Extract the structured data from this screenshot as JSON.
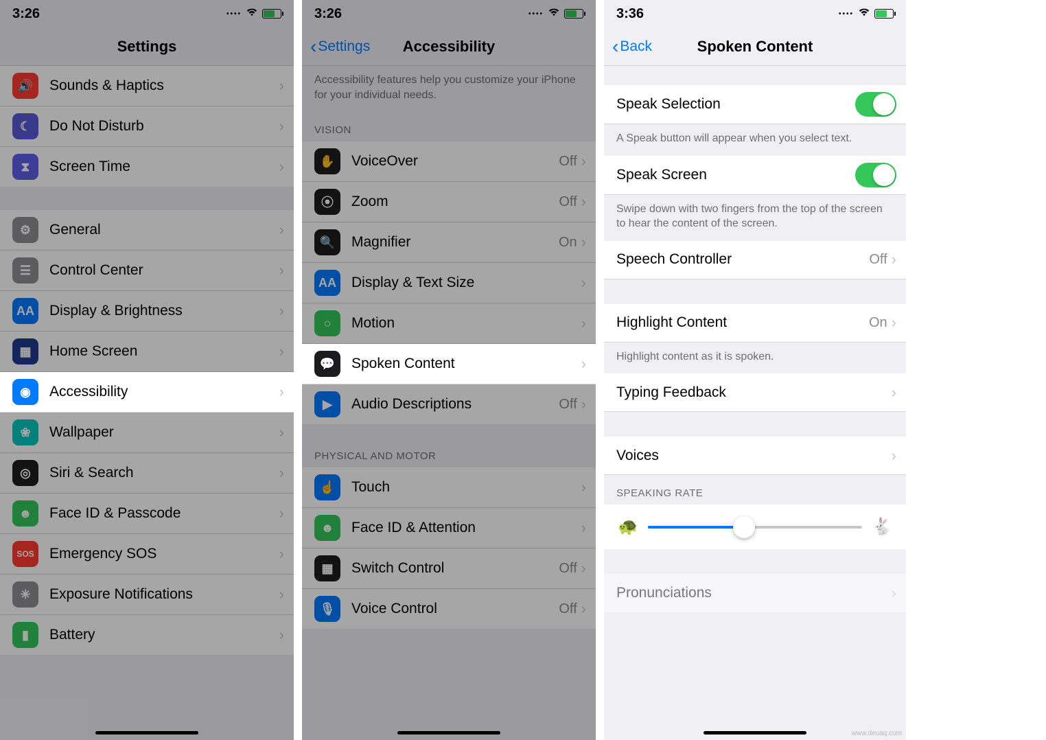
{
  "screens": {
    "settings": {
      "time": "3:26",
      "title": "Settings",
      "groups": [
        {
          "items": [
            {
              "icon": "speaker-icon",
              "color": "ic-red",
              "glyph": "🔊",
              "label": "Sounds & Haptics"
            },
            {
              "icon": "moon-icon",
              "color": "ic-purple",
              "glyph": "☾",
              "label": "Do Not Disturb"
            },
            {
              "icon": "hourglass-icon",
              "color": "ic-indigo",
              "glyph": "⧗",
              "label": "Screen Time"
            }
          ]
        },
        {
          "items": [
            {
              "icon": "gear-icon",
              "color": "ic-gray",
              "glyph": "⚙",
              "label": "General"
            },
            {
              "icon": "switches-icon",
              "color": "ic-gray",
              "glyph": "☰",
              "label": "Control Center"
            },
            {
              "icon": "textsize-icon",
              "color": "ic-blue",
              "glyph": "AA",
              "label": "Display & Brightness"
            },
            {
              "icon": "grid-icon",
              "color": "ic-dkblue",
              "glyph": "▦",
              "label": "Home Screen"
            },
            {
              "icon": "accessibility-icon",
              "color": "ic-blue",
              "glyph": "◉",
              "label": "Accessibility",
              "highlight": true
            },
            {
              "icon": "wallpaper-icon",
              "color": "ic-teal",
              "glyph": "❀",
              "label": "Wallpaper"
            },
            {
              "icon": "siri-icon",
              "color": "ic-black",
              "glyph": "◎",
              "label": "Siri & Search"
            },
            {
              "icon": "faceid-icon",
              "color": "ic-green",
              "glyph": "☻",
              "label": "Face ID & Passcode"
            },
            {
              "icon": "sos-icon",
              "color": "ic-red",
              "glyph": "SOS",
              "label": "Emergency SOS"
            },
            {
              "icon": "exposure-icon",
              "color": "ic-gray",
              "glyph": "✳",
              "label": "Exposure Notifications"
            },
            {
              "icon": "battery-icon",
              "color": "ic-green",
              "glyph": "▮",
              "label": "Battery"
            }
          ]
        }
      ]
    },
    "accessibility": {
      "time": "3:26",
      "back": "Settings",
      "title": "Accessibility",
      "intro": "Accessibility features help you customize your iPhone for your individual needs.",
      "groups": [
        {
          "header": "VISION",
          "items": [
            {
              "icon": "voiceover-icon",
              "color": "ic-black",
              "glyph": "✋",
              "label": "VoiceOver",
              "value": "Off"
            },
            {
              "icon": "zoom-icon",
              "color": "ic-black",
              "glyph": "⦿",
              "label": "Zoom",
              "value": "Off"
            },
            {
              "icon": "magnifier-icon",
              "color": "ic-black",
              "glyph": "🔍",
              "label": "Magnifier",
              "value": "On"
            },
            {
              "icon": "textsize-icon",
              "color": "ic-blue",
              "glyph": "AA",
              "label": "Display & Text Size"
            },
            {
              "icon": "motion-icon",
              "color": "ic-green",
              "glyph": "○",
              "label": "Motion"
            },
            {
              "icon": "spoken-icon",
              "color": "ic-black",
              "glyph": "💬",
              "label": "Spoken Content",
              "highlight": true
            },
            {
              "icon": "audiodesc-icon",
              "color": "ic-blue",
              "glyph": "▶",
              "label": "Audio Descriptions",
              "value": "Off"
            }
          ]
        },
        {
          "header": "PHYSICAL AND MOTOR",
          "items": [
            {
              "icon": "touch-icon",
              "color": "ic-blue",
              "glyph": "☝",
              "label": "Touch"
            },
            {
              "icon": "faceid-icon",
              "color": "ic-green",
              "glyph": "☻",
              "label": "Face ID & Attention"
            },
            {
              "icon": "switch-icon",
              "color": "ic-black",
              "glyph": "▦",
              "label": "Switch Control",
              "value": "Off"
            },
            {
              "icon": "voice-icon",
              "color": "ic-blue",
              "glyph": "🎙",
              "label": "Voice Control",
              "value": "Off"
            }
          ]
        }
      ]
    },
    "spoken": {
      "time": "3:36",
      "back": "Back",
      "title": "Spoken Content",
      "sections": {
        "speakSelection": {
          "label": "Speak Selection",
          "on": true,
          "footer": "A Speak button will appear when you select text."
        },
        "speakScreen": {
          "label": "Speak Screen",
          "on": true,
          "footer": "Swipe down with two fingers from the top of the screen to hear the content of the screen."
        },
        "speechController": {
          "label": "Speech Controller",
          "value": "Off"
        },
        "highlight": {
          "label": "Highlight Content",
          "value": "On",
          "footer": "Highlight content as it is spoken."
        },
        "typing": {
          "label": "Typing Feedback"
        },
        "voices": {
          "label": "Voices"
        },
        "rateHeader": "SPEAKING RATE",
        "sliderPercent": 45,
        "pronunciations": {
          "label": "Pronunciations"
        }
      }
    }
  },
  "watermark": "www.deuaq.com"
}
